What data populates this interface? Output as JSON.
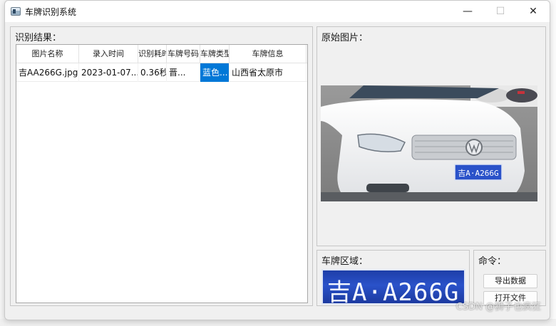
{
  "window": {
    "title": "车牌识别系统",
    "minimize_glyph": "—",
    "maximize_glyph": "☐",
    "close_glyph": "✕"
  },
  "result_group": {
    "title": "识别结果：",
    "columns": [
      "图片名称",
      "录入时间",
      "识别耗时",
      "车牌号码",
      "车牌类型",
      "车牌信息"
    ],
    "rows": [
      {
        "image_name": "吉AA266G.jpg",
        "time": "2023-01-07...",
        "elapsed": "0.36秒",
        "plate_number": "晋...",
        "plate_type": "蓝色...",
        "plate_info": "山西省太原市"
      }
    ]
  },
  "original_group": {
    "title": "原始图片："
  },
  "photo": {
    "plate_text": "吉A·A266G"
  },
  "plate_group": {
    "title": "车牌区域：",
    "plate_text": "吉A·A266G"
  },
  "command_group": {
    "title": "命令：",
    "export_label": "导出数据",
    "open_label": "打开文件"
  },
  "watermark": "CSDN @狮子也疯狂",
  "colors": {
    "selection": "#0078d7",
    "plate_blue": "#2a52c9",
    "car_white": "#f4f5f6"
  }
}
